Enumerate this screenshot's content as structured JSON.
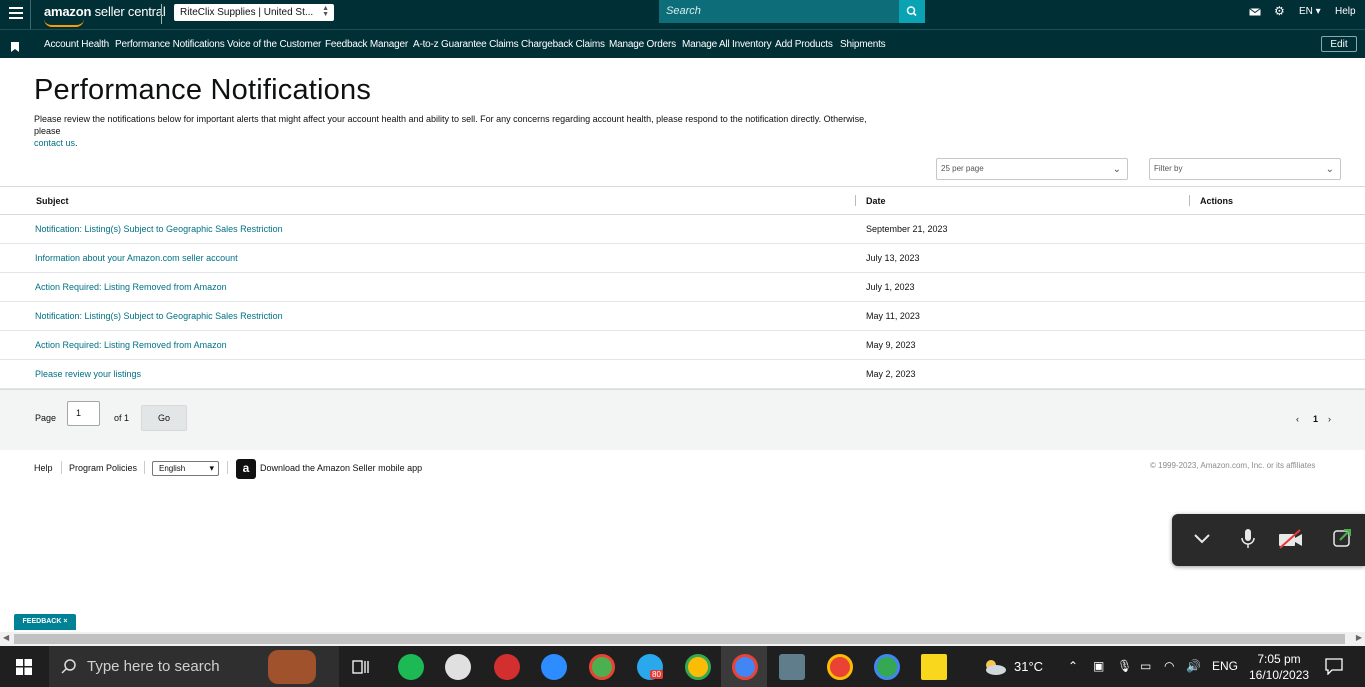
{
  "header": {
    "logo_main": "amazon",
    "logo_sub": "seller central",
    "account_selector": "RiteClix Supplies | United St...",
    "search_placeholder": "Search",
    "language": "EN",
    "help": "Help"
  },
  "nav": {
    "items": [
      "Account Health",
      "Performance Notifications",
      "Voice of the Customer",
      "Feedback Manager",
      "A-to-z Guarantee Claims",
      "Chargeback Claims",
      "Manage Orders",
      "Manage All Inventory",
      "Add Products",
      "Shipments"
    ],
    "edit_label": "Edit"
  },
  "page": {
    "title": "Performance Notifications",
    "description": "Please review the notifications below for important alerts that might affect your account health and ability to sell. For any concerns regarding account health, please respond to the notification directly. Otherwise, please",
    "contact_link": "contact us",
    "per_page": "25 per page",
    "filter_placeholder": "Filter by"
  },
  "table": {
    "headers": {
      "subject": "Subject",
      "date": "Date",
      "actions": "Actions"
    },
    "rows": [
      {
        "subject": "Notification: Listing(s) Subject to Geographic Sales Restriction",
        "date": "September 21, 2023"
      },
      {
        "subject": "Information about your Amazon.com seller account",
        "date": "July 13, 2023"
      },
      {
        "subject": "Action Required: Listing Removed from Amazon",
        "date": "July 1, 2023"
      },
      {
        "subject": "Notification: Listing(s) Subject to Geographic Sales Restriction",
        "date": "May 11, 2023"
      },
      {
        "subject": "Action Required: Listing Removed from Amazon",
        "date": "May 9, 2023"
      },
      {
        "subject": "Please review your listings",
        "date": "May 2, 2023"
      }
    ]
  },
  "pagination": {
    "page_label": "Page",
    "page_value": "1",
    "of_label": "of 1",
    "go_label": "Go",
    "current_page": "1"
  },
  "footer": {
    "help": "Help",
    "program_policies": "Program Policies",
    "language": "English",
    "app_promo": "Download the Amazon Seller mobile app",
    "copyright": "© 1999-2023, Amazon.com, Inc. or its affiliates"
  },
  "feedback": {
    "label": "FEEDBACK ×"
  },
  "taskbar": {
    "search_placeholder": "Type here to search",
    "weather": "31°C",
    "language": "ENG",
    "time": "7:05 pm",
    "date": "16/10/2023",
    "telegram_badge": "80"
  }
}
